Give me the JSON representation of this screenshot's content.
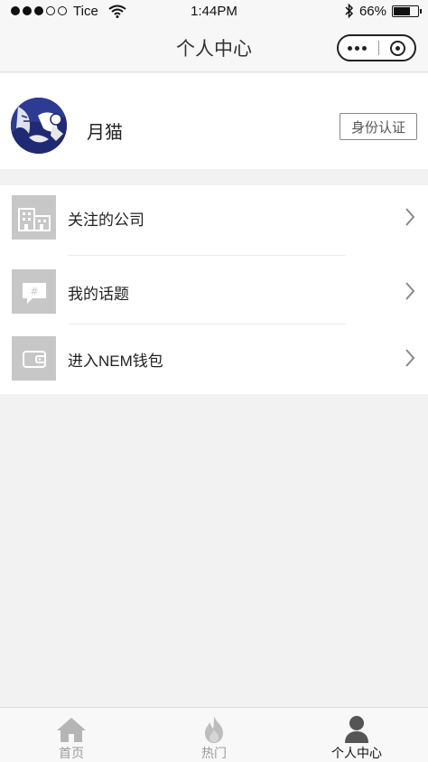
{
  "status_bar": {
    "carrier": "Tice",
    "time": "1:44PM",
    "battery": "66%"
  },
  "navbar": {
    "title": "个人中心"
  },
  "profile": {
    "username": "月猫",
    "verify_label": "身份认证"
  },
  "menu": {
    "items": [
      {
        "label": "关注的公司",
        "icon": "building-icon"
      },
      {
        "label": "我的话题",
        "icon": "topic-icon"
      },
      {
        "label": "进入NEM钱包",
        "icon": "wallet-icon"
      }
    ]
  },
  "tabbar": {
    "tabs": [
      {
        "label": "首页",
        "icon": "home-icon",
        "active": false
      },
      {
        "label": "热门",
        "icon": "flame-icon",
        "active": false
      },
      {
        "label": "个人中心",
        "icon": "person-icon",
        "active": true
      }
    ]
  },
  "colors": {
    "page_bg": "#f2f2f2",
    "icon_bg": "#c7c7c7",
    "avatar_bg": "#1f2a72",
    "tab_active": "#111111",
    "tab_inactive": "#9a9a9a"
  }
}
